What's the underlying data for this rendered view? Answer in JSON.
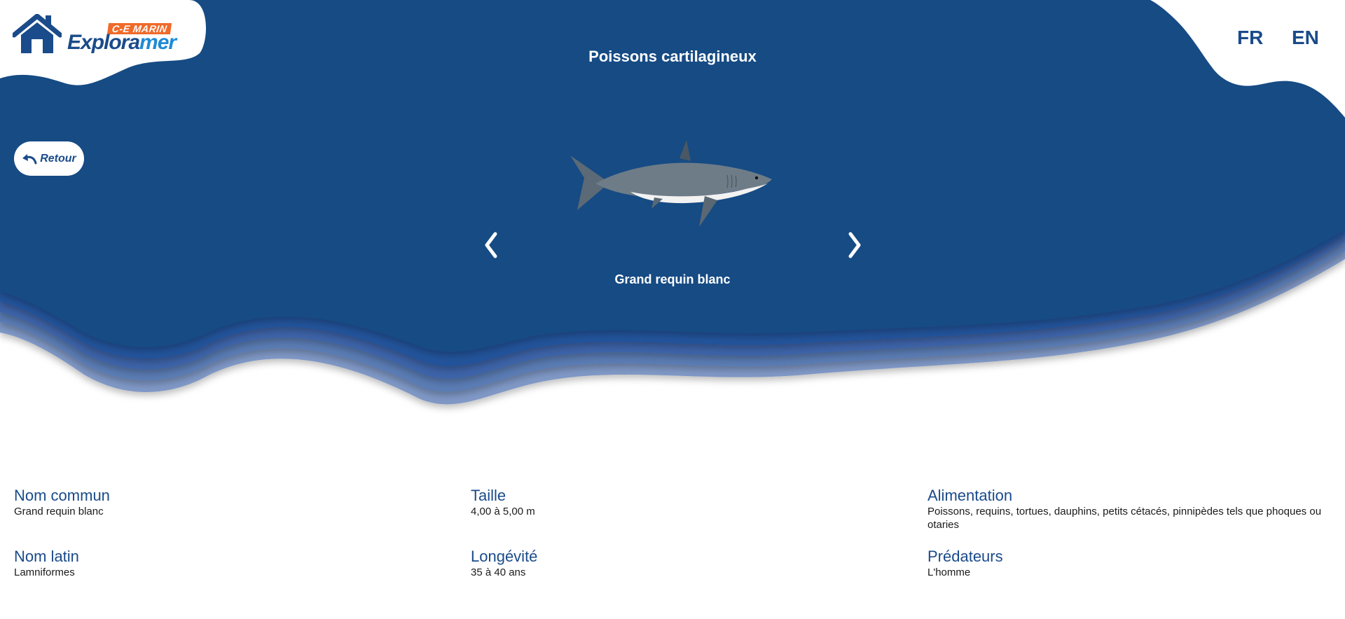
{
  "header": {
    "logo": {
      "badge": "C-E MARIN",
      "name_part1": "Explora",
      "name_part2": "mer",
      "icon": "home-icon"
    },
    "title": "Poissons cartilagineux",
    "languages": [
      "FR",
      "EN"
    ]
  },
  "nav": {
    "back_label": "Retour",
    "back_icon": "undo-arrow-icon",
    "prev_icon": "chevron-left-icon",
    "next_icon": "chevron-right-icon"
  },
  "carousel": {
    "species_name": "Grand requin blanc",
    "image": "great-white-shark-illustration"
  },
  "details": {
    "common_name": {
      "label": "Nom commun",
      "value": "Grand requin blanc"
    },
    "size": {
      "label": "Taille",
      "value": "4,00 à 5,00 m"
    },
    "diet": {
      "label": "Alimentation",
      "value": "Poissons, requins, tortues, dauphins, petits cétacés, pinnipèdes tels que phoques ou otaries"
    },
    "latin_name": {
      "label": "Nom latin",
      "value": "Lamniformes"
    },
    "longevity": {
      "label": "Longévité",
      "value": "35 à 40 ans"
    },
    "predators": {
      "label": "Prédateurs",
      "value": "L'homme"
    }
  },
  "colors": {
    "ocean": "#184c84",
    "wave_1": "#21529a",
    "wave_2": "#3c64a8",
    "wave_3": "#5a7bb4",
    "wave_4": "#7f98c6",
    "heading": "#1a4b8a",
    "logo_badge": "#f06a2a",
    "logo_accent": "#1e8ad6"
  }
}
